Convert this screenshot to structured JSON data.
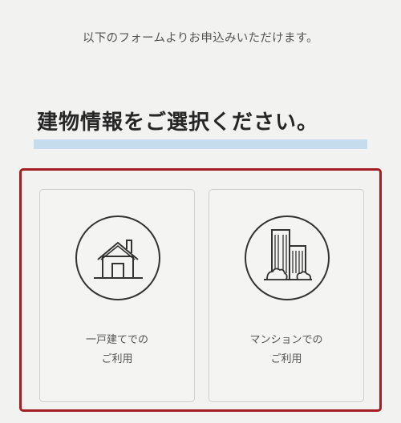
{
  "intro": {
    "text": "以下のフォームよりお申込みいただけます。"
  },
  "heading": {
    "text": "建物情報をご選択ください。"
  },
  "options": [
    {
      "icon": "house-icon",
      "label_line1": "一戸建てでの",
      "label_line2": "ご利用"
    },
    {
      "icon": "apartment-building-icon",
      "label_line1": "マンションでの",
      "label_line2": "ご利用"
    }
  ],
  "colors": {
    "background": "#f2f2f1",
    "selection_border": "#a31d22",
    "heading_underline": "#c4dcec",
    "card_border": "#d0d0ce"
  }
}
